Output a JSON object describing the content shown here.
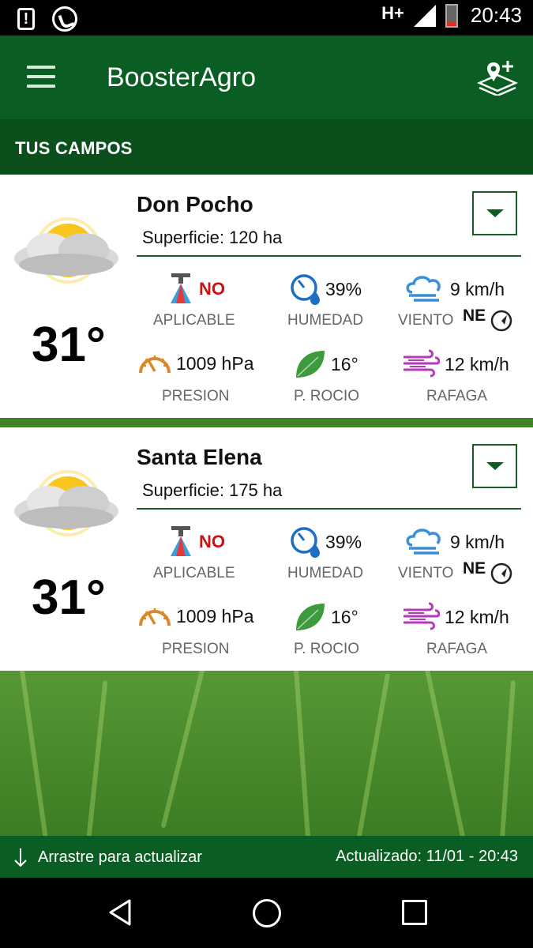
{
  "status_bar": {
    "network": "H+",
    "time": "20:43"
  },
  "app_bar": {
    "title": "BoosterAgro"
  },
  "section": {
    "title": "TUS CAMPOS"
  },
  "fields": [
    {
      "name": "Don Pocho",
      "surface": "Superficie: 120 ha",
      "temperature": "31°",
      "aplicable": {
        "value": "NO",
        "label": "APLICABLE"
      },
      "humedad": {
        "value": "39%",
        "label": "HUMEDAD"
      },
      "viento": {
        "value": "9 km/h",
        "label": "VIENTO",
        "direction": "NE"
      },
      "presion": {
        "value": "1009 hPa",
        "label": "PRESION"
      },
      "rocio": {
        "value": "16°",
        "label": "P. ROCIO"
      },
      "rafaga": {
        "value": "12 km/h",
        "label": "RAFAGA"
      }
    },
    {
      "name": "Santa Elena",
      "surface": "Superficie: 175 ha",
      "temperature": "31°",
      "aplicable": {
        "value": "NO",
        "label": "APLICABLE"
      },
      "humedad": {
        "value": "39%",
        "label": "HUMEDAD"
      },
      "viento": {
        "value": "9 km/h",
        "label": "VIENTO",
        "direction": "NE"
      },
      "presion": {
        "value": "1009 hPa",
        "label": "PRESION"
      },
      "rocio": {
        "value": "16°",
        "label": "P. ROCIO"
      },
      "rafaga": {
        "value": "12 km/h",
        "label": "RAFAGA"
      }
    }
  ],
  "footer": {
    "pull_text": "Arrastre para actualizar",
    "updated_text": "Actualizado: 11/01 - 20:43"
  },
  "colors": {
    "primary": "#0b5e23",
    "section": "#0a4f1c",
    "aplicable_no": "#cc1111",
    "humidity_icon": "#1e6fc4",
    "wind_icon": "#3b8fd8",
    "pressure_icon": "#d9892a",
    "dew_icon": "#3d9a3d",
    "gust_icon": "#b23ab8"
  }
}
